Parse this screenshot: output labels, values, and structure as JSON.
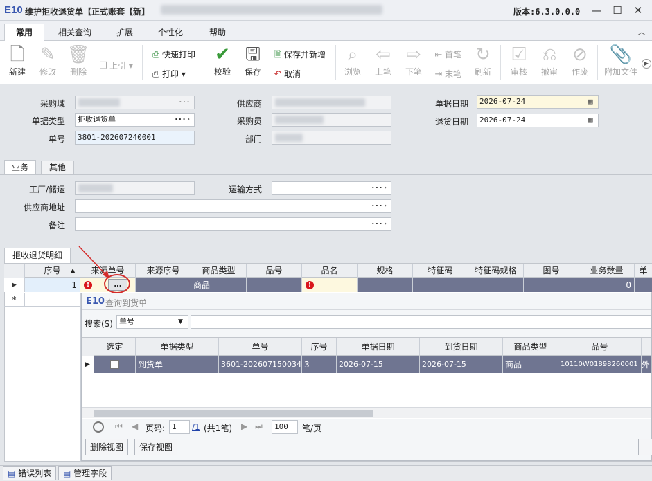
{
  "window": {
    "logo": "E10",
    "title": "维护拒收退货单【正式账套【新】",
    "version": "版本:6.3.0.0.0",
    "minimize": "—",
    "maximize": "☐",
    "close": "✕"
  },
  "menu_tabs": [
    "常用",
    "相关查询",
    "扩展",
    "个性化",
    "帮助"
  ],
  "toolbar": {
    "new": "新建",
    "edit": "修改",
    "delete": "删除",
    "prev_lead": "上引",
    "quick_print": "快速打印",
    "print": "打印",
    "check": "校验",
    "save": "保存",
    "save_new": "保存并新增",
    "cancel": "取消",
    "browse": "浏览",
    "prev": "上笔",
    "next": "下笔",
    "first": "首笔",
    "last": "末笔",
    "refresh": "刷新",
    "approve": "审核",
    "unapprove": "撤审",
    "void": "作废",
    "attach": "附加文件"
  },
  "header": {
    "purchase_domain_label": "采购域",
    "doc_type_label": "单据类型",
    "doc_type_value": "拒收退货单",
    "doc_no_label": "单号",
    "doc_no_value": "3801-202607240001",
    "supplier_label": "供应商",
    "buyer_label": "采购员",
    "dept_label": "部门",
    "doc_date_label": "单据日期",
    "doc_date_value": "2026-07-24",
    "return_date_label": "退货日期",
    "return_date_value": "2026-07-24"
  },
  "section_tabs": [
    "业务",
    "其他"
  ],
  "business": {
    "plant_label": "工厂/储运",
    "transport_label": "运输方式",
    "supplier_addr_label": "供应商地址",
    "remark_label": "备注"
  },
  "detail_tab": "拒收退货明细",
  "detail_grid": {
    "columns": [
      "序号",
      "来源单号",
      "来源序号",
      "商品类型",
      "品号",
      "品名",
      "规格",
      "特征码",
      "特征码规格",
      "图号",
      "业务数量",
      "单"
    ],
    "row": {
      "seq": "1",
      "source_no": "…",
      "product_type": "商品",
      "qty": "0"
    },
    "new_row_marker": "*"
  },
  "popup": {
    "logo": "E10",
    "title": "查询到货单",
    "search_label": "搜索(S)",
    "search_field": "单号",
    "columns": [
      "选定",
      "单据类型",
      "单号",
      "序号",
      "单据日期",
      "到货日期",
      "商品类型",
      "品号",
      "外"
    ],
    "rows": [
      {
        "selected": "",
        "doc_type": "到货单",
        "doc_no": "3601-202607150034",
        "seq": "3",
        "doc_date": "2026-07-15",
        "arrival_date": "2026-07-15",
        "product_type": "商品",
        "item_no": "10110W01898260001",
        "extra": "外"
      }
    ],
    "pager": {
      "page_label": "页码:",
      "page_value": "1",
      "total_pages": "/1",
      "count_text": "(共1笔)",
      "page_size": "100",
      "page_size_unit": "笔/页"
    },
    "delete_view": "删除视图",
    "save_view": "保存视图"
  },
  "bottom_tabs": [
    "错误列表",
    "管理字段"
  ]
}
